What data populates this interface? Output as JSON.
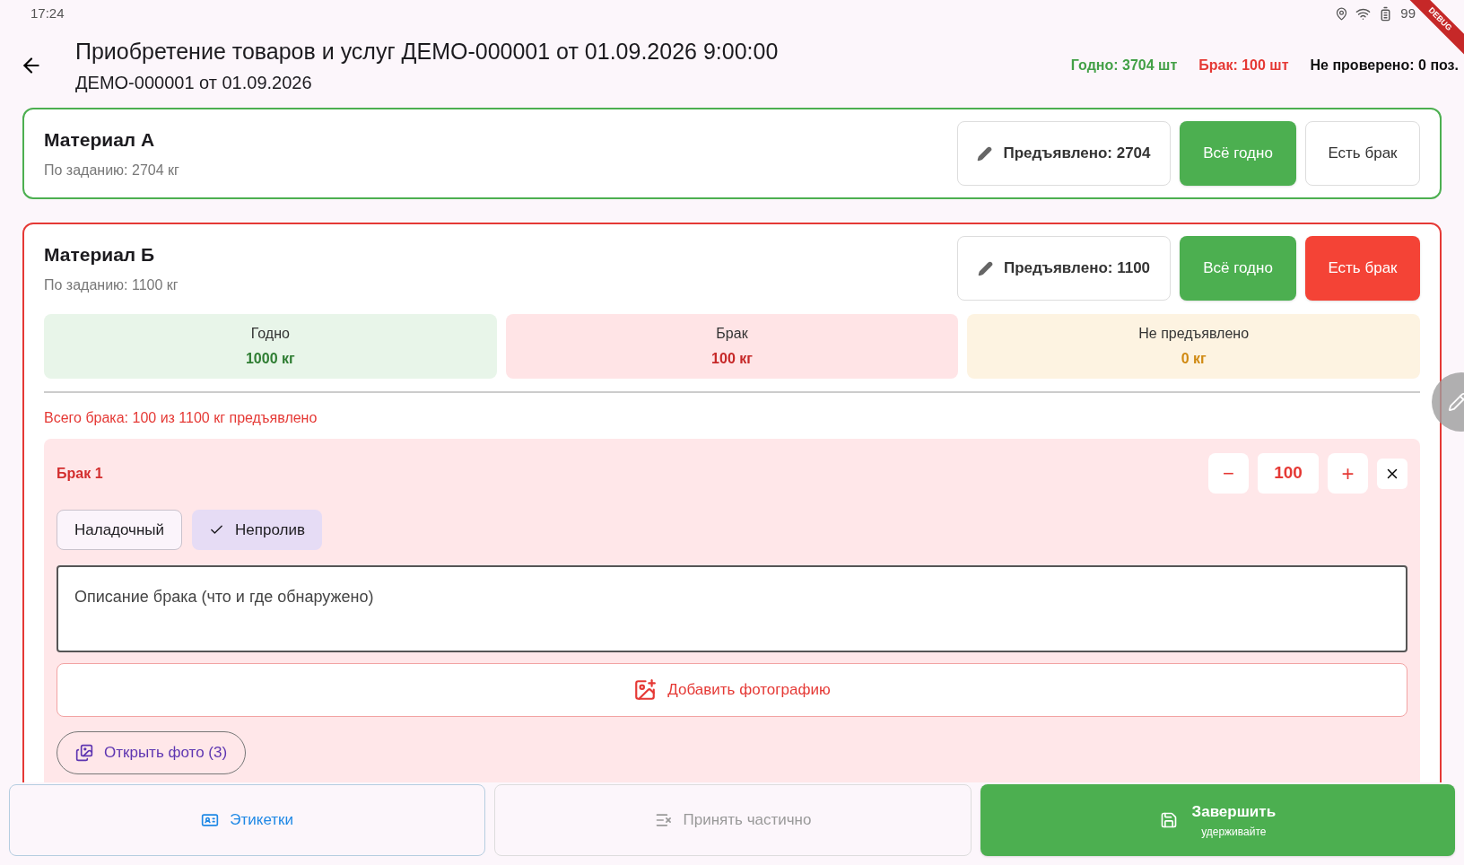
{
  "status_bar": {
    "time": "17:24",
    "battery": "99",
    "debug_banner": "DEBUG"
  },
  "header": {
    "title": "Приобретение товаров и услуг ДЕМО-000001 от 01.09.2026 9:00:00",
    "subtitle": "ДЕМО-000001 от 01.09.2026",
    "totals": [
      {
        "text": "Годно: 3704 шт",
        "color": "#43a047"
      },
      {
        "text": "Брак: 100 шт",
        "color": "#e53935"
      },
      {
        "text": "Не проверено: 0 поз.",
        "color": "#111111"
      }
    ]
  },
  "materials": [
    {
      "name": "Материал А",
      "planned": "По заданию: 2704 кг",
      "presented": "Предъявлено: 2704",
      "ok_button": "Всё годно",
      "defect_button": "Есть брак",
      "defect": false
    },
    {
      "name": "Материал Б",
      "planned": "По заданию: 1100 кг",
      "presented": "Предъявлено: 1100",
      "ok_button": "Всё годно",
      "defect_button": "Есть брак",
      "defect": true,
      "summary": [
        {
          "label": "Годно",
          "value": "1000 кг",
          "kind": "good"
        },
        {
          "label": "Брак",
          "value": "100 кг",
          "kind": "defect"
        },
        {
          "label": "Не предъявлено",
          "value": "0 кг",
          "kind": "pending"
        }
      ],
      "defect_total": "Всего брака: 100 из 1100 кг предъявлено",
      "defects": [
        {
          "title": "Брак 1",
          "quantity": "100",
          "minus": "−",
          "plus": "+",
          "types": [
            {
              "label": "Наладочный",
              "selected": false
            },
            {
              "label": "Непролив",
              "selected": true
            }
          ],
          "description_placeholder": "Описание брака (что и где обнаружено)",
          "add_photo": "Добавить фотографию",
          "open_photo": "Открыть фото (3)"
        }
      ]
    }
  ],
  "bottom_bar": {
    "labels": {
      "label": "Этикетки"
    },
    "partial": {
      "label": "Принять частично",
      "disabled": true
    },
    "finish": {
      "label": "Завершить",
      "hint": "удерживайте"
    }
  }
}
